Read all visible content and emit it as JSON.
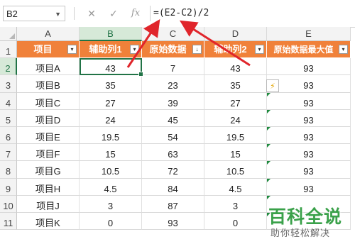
{
  "formula_bar": {
    "name_box": "B2",
    "cancel_icon": "✕",
    "enter_icon": "✓",
    "fx_label": "fx",
    "formula": "=(E2-C2)/2"
  },
  "columns": [
    "A",
    "B",
    "C",
    "D",
    "E"
  ],
  "rows": [
    "1",
    "2",
    "3",
    "4",
    "5",
    "6",
    "7",
    "8",
    "9",
    "10",
    "11"
  ],
  "header": [
    "项目",
    "辅助列1",
    "原始数据",
    "辅助列2",
    "原始数据最大值"
  ],
  "data": [
    [
      "项目A",
      "43",
      "7",
      "43",
      "93"
    ],
    [
      "项目B",
      "35",
      "23",
      "35",
      "93"
    ],
    [
      "项目C",
      "27",
      "39",
      "27",
      "93"
    ],
    [
      "项目D",
      "24",
      "45",
      "24",
      "93"
    ],
    [
      "项目E",
      "19.5",
      "54",
      "19.5",
      "93"
    ],
    [
      "项目F",
      "15",
      "63",
      "15",
      "93"
    ],
    [
      "项目G",
      "10.5",
      "72",
      "10.5",
      "93"
    ],
    [
      "项目H",
      "4.5",
      "84",
      "4.5",
      "93"
    ],
    [
      "项目J",
      "3",
      "87",
      "3",
      ""
    ],
    [
      "项目K",
      "0",
      "93",
      "0",
      ""
    ]
  ],
  "colors": {
    "header_fill": "#f0813a",
    "select_green": "#217346",
    "arrow_red": "#e0252b"
  },
  "watermark": {
    "title": "百科全说",
    "subtitle": "助你轻松解决"
  }
}
